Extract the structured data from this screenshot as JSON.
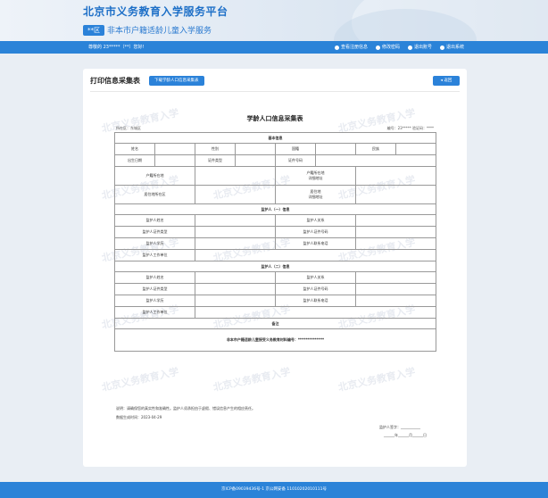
{
  "header": {
    "platform_title": "北京市义务教育入学服务平台",
    "district_badge": "**区",
    "sub_title": "非本市户籍适龄儿童入学服务"
  },
  "nav": {
    "greeting": "尊敬的 23*****（**）您好!",
    "links": [
      {
        "icon": "user-icon",
        "label": "查看注册信息"
      },
      {
        "icon": "lock-icon",
        "label": "修改密码"
      },
      {
        "icon": "circle-icon",
        "label": "退出账号"
      },
      {
        "icon": "logout-icon",
        "label": "退出系统"
      }
    ]
  },
  "card": {
    "title": "打印信息采集表",
    "download_label": "下载学龄人口信息采集表",
    "back_label": "◂ 返回"
  },
  "doc": {
    "title": "学龄人口信息采集表",
    "district": "所在区：东城区",
    "serial": "编号：23***** 验证码：****",
    "watermark": "北京义务教育入学",
    "sections": {
      "basic": "基本信息",
      "guardian1": "监护人（一）信息",
      "guardian2": "监护人（二）信息",
      "remark": "备注"
    },
    "basic_labels": {
      "name": "姓名",
      "gender": "性别",
      "nationality": "国籍",
      "ethnicity": "民族",
      "birth_date": "出生日期",
      "id_type": "证件类型",
      "id_number": "证件号码",
      "hukou_location": "户籍所在地",
      "hukou_address": "户籍所在地\n详细地址",
      "residence_district": "居住地所在区",
      "residence_address": "居住地\n详细地址"
    },
    "guardian_labels": {
      "name": "监护人姓名",
      "relation": "监护人关系",
      "id_type": "监护人证件类型",
      "id_number": "监护人证件号码",
      "education": "监护人学历",
      "phone": "监护人联系电话",
      "employer": "监护人工作单位"
    },
    "footer_row": "非本市户籍适龄儿童接受义务教育材料编号：**************",
    "note": "说明：请确保您的真实性和准确性。监护人须承担由于虚假、错误信息产生的相应责任。",
    "generated_date": "数据生成时间：2023-04-29",
    "signature": "监护人签字：___________",
    "sign_date": "______年______月______日"
  },
  "footer": {
    "text": "京ICP备09039436号-1 京公网安备 11010202010111号"
  }
}
